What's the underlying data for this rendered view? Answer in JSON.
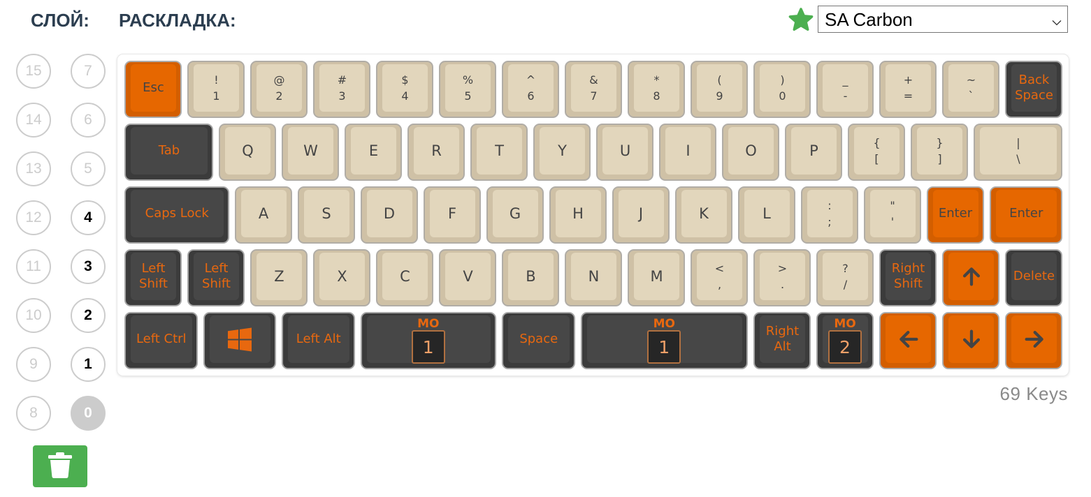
{
  "header": {
    "layer_title": "СЛОЙ:",
    "layout_title": "РАСКЛАДКА:"
  },
  "keymap_select": {
    "value": "SA Carbon",
    "favorite_icon": "star-icon",
    "favorite_color": "#4caf50",
    "dropdown_icon": "chevron-down-icon"
  },
  "layers": {
    "columns": [
      [
        {
          "n": "15",
          "state": "empty"
        },
        {
          "n": "14",
          "state": "empty"
        },
        {
          "n": "13",
          "state": "empty"
        },
        {
          "n": "12",
          "state": "empty"
        },
        {
          "n": "11",
          "state": "empty"
        },
        {
          "n": "10",
          "state": "empty"
        },
        {
          "n": "9",
          "state": "empty"
        },
        {
          "n": "8",
          "state": "empty"
        }
      ],
      [
        {
          "n": "7",
          "state": "empty"
        },
        {
          "n": "6",
          "state": "empty"
        },
        {
          "n": "5",
          "state": "empty"
        },
        {
          "n": "4",
          "state": "used"
        },
        {
          "n": "3",
          "state": "used"
        },
        {
          "n": "2",
          "state": "used"
        },
        {
          "n": "1",
          "state": "used"
        },
        {
          "n": "0",
          "state": "active"
        }
      ]
    ],
    "delete_icon": "trash-icon",
    "delete_color": "#4caf50"
  },
  "palette": {
    "alpha_cap": "#e2d6bc",
    "mod_cap": "#474747",
    "accent_cap": "#e66700",
    "legend_dark": "#444444",
    "legend_orange": "#e8680f"
  },
  "keyboard": {
    "key_count": "69 Keys",
    "rows": [
      {
        "keys": [
          {
            "cap": "accent",
            "legend": [
              "Esc"
            ]
          },
          {
            "cap": "alpha",
            "legend": [
              "!",
              "1"
            ]
          },
          {
            "cap": "alpha",
            "legend": [
              "@",
              "2"
            ]
          },
          {
            "cap": "alpha",
            "legend": [
              "#",
              "3"
            ]
          },
          {
            "cap": "alpha",
            "legend": [
              "$",
              "4"
            ]
          },
          {
            "cap": "alpha",
            "legend": [
              "%",
              "5"
            ]
          },
          {
            "cap": "alpha",
            "legend": [
              "^",
              "6"
            ]
          },
          {
            "cap": "alpha",
            "legend": [
              "&",
              "7"
            ]
          },
          {
            "cap": "alpha",
            "legend": [
              "*",
              "8"
            ]
          },
          {
            "cap": "alpha",
            "legend": [
              "(",
              "9"
            ]
          },
          {
            "cap": "alpha",
            "legend": [
              ")",
              "0"
            ]
          },
          {
            "cap": "alpha",
            "legend": [
              "_",
              "-"
            ]
          },
          {
            "cap": "alpha",
            "legend": [
              "+",
              "="
            ]
          },
          {
            "cap": "alpha",
            "legend": [
              "~",
              "`"
            ]
          },
          {
            "cap": "mod",
            "legend": [
              "Back",
              "Space"
            ]
          }
        ]
      },
      {
        "keys": [
          {
            "cap": "mod",
            "legend": [
              "Tab"
            ]
          },
          {
            "cap": "alpha",
            "legend": [
              "Q"
            ]
          },
          {
            "cap": "alpha",
            "legend": [
              "W"
            ]
          },
          {
            "cap": "alpha",
            "legend": [
              "E"
            ]
          },
          {
            "cap": "alpha",
            "legend": [
              "R"
            ]
          },
          {
            "cap": "alpha",
            "legend": [
              "T"
            ]
          },
          {
            "cap": "alpha",
            "legend": [
              "Y"
            ]
          },
          {
            "cap": "alpha",
            "legend": [
              "U"
            ]
          },
          {
            "cap": "alpha",
            "legend": [
              "I"
            ]
          },
          {
            "cap": "alpha",
            "legend": [
              "O"
            ]
          },
          {
            "cap": "alpha",
            "legend": [
              "P"
            ]
          },
          {
            "cap": "alpha",
            "legend": [
              "{",
              "["
            ]
          },
          {
            "cap": "alpha",
            "legend": [
              "}",
              "]"
            ]
          },
          {
            "cap": "alpha",
            "legend": [
              "|",
              "\\"
            ]
          }
        ]
      },
      {
        "keys": [
          {
            "cap": "mod",
            "legend": [
              "Caps Lock"
            ]
          },
          {
            "cap": "alpha",
            "legend": [
              "A"
            ]
          },
          {
            "cap": "alpha",
            "legend": [
              "S"
            ]
          },
          {
            "cap": "alpha",
            "legend": [
              "D"
            ]
          },
          {
            "cap": "alpha",
            "legend": [
              "F"
            ]
          },
          {
            "cap": "alpha",
            "legend": [
              "G"
            ]
          },
          {
            "cap": "alpha",
            "legend": [
              "H"
            ]
          },
          {
            "cap": "alpha",
            "legend": [
              "J"
            ]
          },
          {
            "cap": "alpha",
            "legend": [
              "K"
            ]
          },
          {
            "cap": "alpha",
            "legend": [
              "L"
            ]
          },
          {
            "cap": "alpha",
            "legend": [
              ":",
              ";"
            ]
          },
          {
            "cap": "alpha",
            "legend": [
              "\"",
              "'"
            ]
          },
          {
            "cap": "accent",
            "legend": [
              "Enter"
            ]
          },
          {
            "cap": "accent",
            "legend": [
              "Enter"
            ]
          }
        ]
      },
      {
        "keys": [
          {
            "cap": "mod",
            "legend": [
              "Left",
              "Shift"
            ]
          },
          {
            "cap": "mod",
            "legend": [
              "Left",
              "Shift"
            ]
          },
          {
            "cap": "alpha",
            "legend": [
              "Z"
            ]
          },
          {
            "cap": "alpha",
            "legend": [
              "X"
            ]
          },
          {
            "cap": "alpha",
            "legend": [
              "C"
            ]
          },
          {
            "cap": "alpha",
            "legend": [
              "V"
            ]
          },
          {
            "cap": "alpha",
            "legend": [
              "B"
            ]
          },
          {
            "cap": "alpha",
            "legend": [
              "N"
            ]
          },
          {
            "cap": "alpha",
            "legend": [
              "M"
            ]
          },
          {
            "cap": "alpha",
            "legend": [
              "<",
              ","
            ]
          },
          {
            "cap": "alpha",
            "legend": [
              ">",
              "."
            ]
          },
          {
            "cap": "alpha",
            "legend": [
              "?",
              "/"
            ]
          },
          {
            "cap": "mod",
            "legend": [
              "Right",
              "Shift"
            ]
          },
          {
            "cap": "accent",
            "icon": "arrow-up-icon"
          },
          {
            "cap": "mod",
            "legend": [
              "Delete"
            ]
          }
        ]
      },
      {
        "keys": [
          {
            "cap": "mod",
            "legend": [
              "Left Ctrl"
            ]
          },
          {
            "cap": "mod",
            "icon": "windows-logo-icon"
          },
          {
            "cap": "mod",
            "legend": [
              "Left Alt"
            ]
          },
          {
            "cap": "mod",
            "legend": [
              "MO"
            ],
            "layer": "1"
          },
          {
            "cap": "mod",
            "legend": [
              "Space"
            ]
          },
          {
            "cap": "mod",
            "legend": [
              "MO"
            ],
            "layer": "1"
          },
          {
            "cap": "mod",
            "legend": [
              "Right",
              "Alt"
            ]
          },
          {
            "cap": "mod",
            "legend": [
              "MO"
            ],
            "layer": "2"
          },
          {
            "cap": "accent",
            "icon": "arrow-left-icon"
          },
          {
            "cap": "accent",
            "icon": "arrow-down-icon"
          },
          {
            "cap": "accent",
            "icon": "arrow-right-icon"
          }
        ]
      }
    ]
  }
}
